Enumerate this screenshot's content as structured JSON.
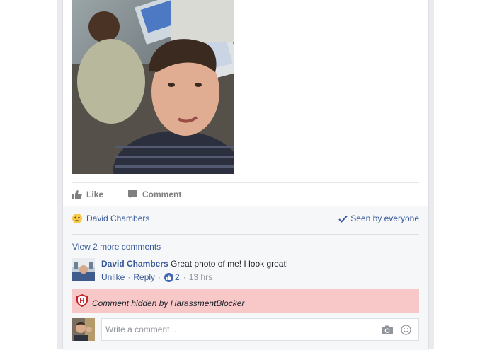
{
  "post": {
    "like_label": "Like",
    "comment_label": "Comment"
  },
  "reactions": {
    "liker_name": "David Chambers",
    "seen_label": "Seen by everyone"
  },
  "comments": {
    "view_more_label": "View 2 more comments",
    "items": [
      {
        "author": "David Chambers",
        "text": "Great photo of me! I look great!",
        "unlike_label": "Unlike",
        "reply_label": "Reply",
        "like_count": "2",
        "time": "13 hrs"
      }
    ],
    "hidden_notice": "Comment hidden by HarassmentBlocker"
  },
  "composer": {
    "placeholder": "Write a comment..."
  },
  "colors": {
    "link": "#365899",
    "hidden_bar": "#f8c8c8",
    "muted": "#90949c"
  }
}
